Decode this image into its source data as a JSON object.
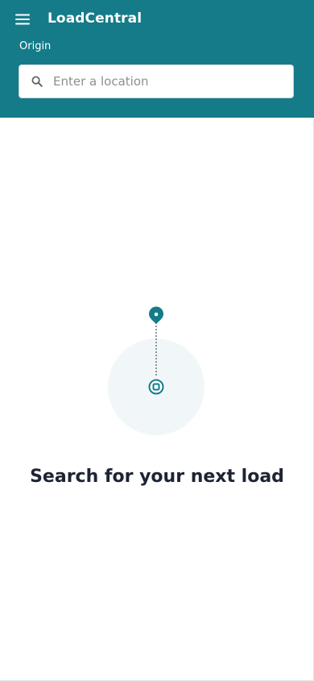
{
  "header": {
    "menu_icon": "hamburger-menu-icon",
    "app_title": "LoadCentral",
    "origin_label": "Origin",
    "search": {
      "icon": "search-icon",
      "placeholder": "Enter a location",
      "value": ""
    }
  },
  "empty_state": {
    "pin_icon": "location-pin-icon",
    "target_icon": "target-icon",
    "heading": "Search for your next load"
  },
  "colors": {
    "brand": "#157b89",
    "heading_text": "#1d2432",
    "circle_bg": "#f1f7f8"
  }
}
